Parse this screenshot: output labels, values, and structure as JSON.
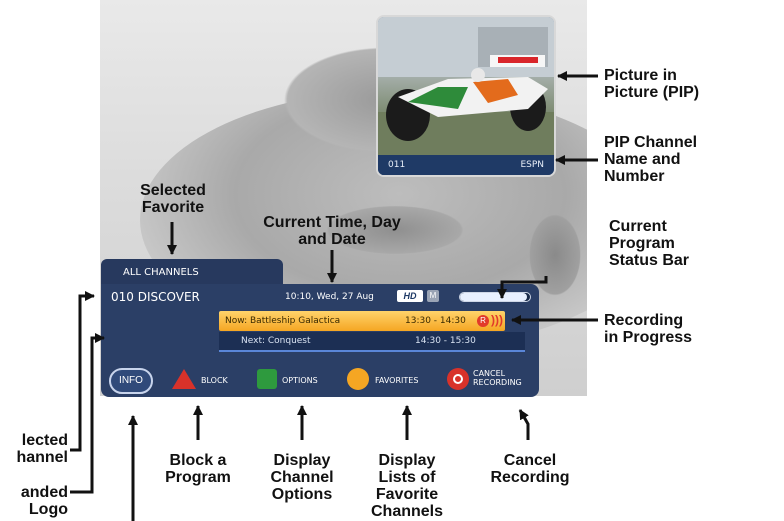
{
  "tv_screen": {
    "tab_label": "ALL CHANNELS",
    "channel": "010 DISCOVER",
    "time_date": "10:10, Wed, 27 Aug",
    "hd_badge": "HD",
    "m_badge": "M",
    "status_progress": 0.95,
    "now_title": "Now: Battleship Galactica",
    "now_time": "13:30 - 14:30",
    "rec_icon": "R",
    "next_title": "Next: Conquest",
    "next_time": "14:30 - 15:30",
    "buttons": {
      "info": "INFO",
      "block": "BLOCK",
      "options": "OPTIONS",
      "favorites": "FAVORITES",
      "cancel_line1": "CANCEL",
      "cancel_line2": "RECORDING"
    },
    "pip_channel_number": "011",
    "pip_channel_name": "ESPN"
  },
  "annotations": {
    "pip": [
      "Picture in",
      "Picture (PIP)"
    ],
    "pip_channel": [
      "PIP Channel",
      "Name and",
      "Number"
    ],
    "selected_favorite": [
      "Selected",
      "Favorite"
    ],
    "current_time": [
      "Current Time, Day",
      "and Date"
    ],
    "status_bar": [
      "Current",
      "Program",
      "Status Bar"
    ],
    "recording": [
      "Recording",
      "in Progress"
    ],
    "selected_channel": [
      "lected",
      "hannel"
    ],
    "branded_logo": [
      "anded",
      "Logo"
    ],
    "block": [
      "Block a",
      "Program"
    ],
    "channel_options": [
      "Display",
      "Channel",
      "Options"
    ],
    "favorite_lists": [
      "Display",
      "Lists of",
      "Favorite",
      "Channels"
    ],
    "cancel_recording": [
      "Cancel",
      "Recording"
    ]
  },
  "colors": {
    "banner": "#2b3f66",
    "now_highlight": "#f5a623",
    "block_button": "#d8322a",
    "options_button": "#2e9a3e",
    "favorites_button": "#f5a623",
    "cancel_button": "#d8322a"
  }
}
